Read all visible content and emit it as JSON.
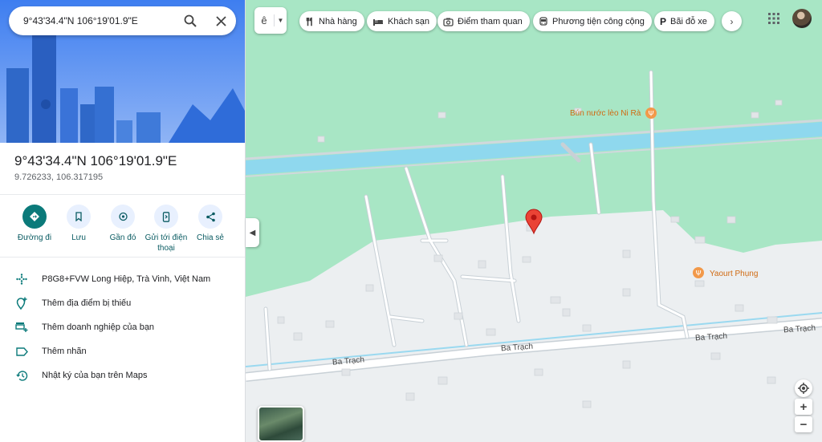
{
  "search": {
    "query": "9°43'34.4\"N 106°19'01.9\"E"
  },
  "place": {
    "title": "9°43'34.4\"N 106°19'01.9\"E",
    "coords": "9.726233, 106.317195"
  },
  "actions": [
    {
      "label": "Đường đi",
      "icon": "directions-icon"
    },
    {
      "label": "Lưu",
      "icon": "bookmark-icon"
    },
    {
      "label": "Gần đó",
      "icon": "nearby-icon"
    },
    {
      "label": "Gửi tới điện thoại",
      "icon": "send-to-phone-icon"
    },
    {
      "label": "Chia sẻ",
      "icon": "share-icon"
    }
  ],
  "info": [
    {
      "text": "P8G8+FVW Long Hiệp, Trà Vinh, Việt Nam",
      "icon": "plus-code-icon"
    },
    {
      "text": "Thêm địa điểm bị thiếu",
      "icon": "add-place-icon"
    },
    {
      "text": "Thêm doanh nghiệp của bạn",
      "icon": "add-business-icon"
    },
    {
      "text": "Thêm nhãn",
      "icon": "label-icon"
    },
    {
      "text": "Nhật ký của bạn trên Maps",
      "icon": "history-icon"
    }
  ],
  "chips": [
    {
      "label": "Nhà hàng",
      "icon": "restaurant-icon"
    },
    {
      "label": "Khách sạn",
      "icon": "hotel-icon"
    },
    {
      "label": "Điểm tham quan",
      "icon": "camera-icon"
    },
    {
      "label": "Phương tiện công cộng",
      "icon": "transit-icon"
    },
    {
      "label": "Bãi đỗ xe",
      "icon": "parking-icon"
    }
  ],
  "map": {
    "labels": {
      "restaurant": "Bún nước lèo Ni Rà",
      "shop": "Yaourt Phụng",
      "road1": "Ba Trạch",
      "road2": "Ba Trạch",
      "road3": "Ba Trạch",
      "road4": "Ba Trạch"
    },
    "colors": {
      "land": "#a8e6c5",
      "built": "#eef0f2",
      "water": "#8fd8ee",
      "road": "#ffffff",
      "poi": "#f2994a",
      "pin": "#ea4335",
      "accent": "#0b7a7a"
    }
  },
  "controls": {
    "zoom_in": "+",
    "zoom_out": "−"
  }
}
